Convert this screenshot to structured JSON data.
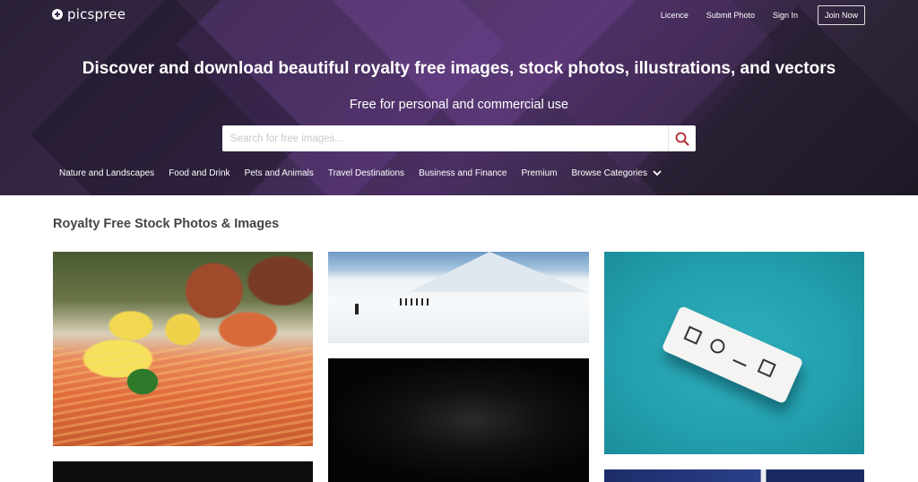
{
  "brand": {
    "name": "picspree",
    "icon": "plus-circle-icon"
  },
  "topnav": {
    "licence": "Licence",
    "submit_photo": "Submit Photo",
    "sign_in": "Sign In",
    "join_now": "Join Now"
  },
  "hero": {
    "headline": "Discover and download beautiful royalty free images, stock photos, illustrations, and vectors",
    "subline": "Free for personal and commercial use"
  },
  "search": {
    "placeholder": "Search for free images...",
    "value": "",
    "button_icon": "search-icon"
  },
  "categories": {
    "items": [
      {
        "label": "Nature and Landscapes"
      },
      {
        "label": "Food and Drink"
      },
      {
        "label": "Pets and Animals"
      },
      {
        "label": "Travel Destinations"
      },
      {
        "label": "Business and Finance"
      },
      {
        "label": "Premium"
      }
    ],
    "browse_label": "Browse Categories",
    "browse_icon": "chevron-down-icon"
  },
  "main": {
    "section_title": "Royalty Free Stock Photos & Images"
  },
  "colors": {
    "hero_bg": "#3b2a4c",
    "search_icon": "#b0262b"
  }
}
